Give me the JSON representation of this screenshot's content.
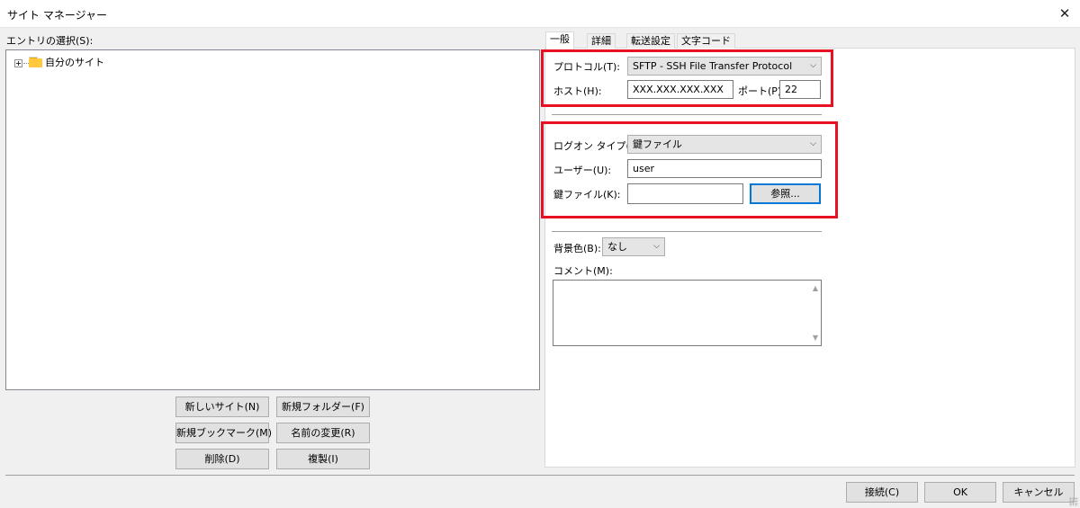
{
  "window": {
    "title": "サイト マネージャー",
    "close_glyph": "✕"
  },
  "tree": {
    "heading": "エントリの選択(S):",
    "items": [
      {
        "label": "自分のサイト",
        "icon": "folder-icon",
        "expanded": false
      }
    ]
  },
  "left_buttons": {
    "new_site": "新しいサイト(N)",
    "new_folder": "新規フォルダー(F)",
    "new_bookmark": "新規ブックマーク(M)",
    "rename": "名前の変更(R)",
    "delete": "削除(D)",
    "duplicate": "複製(I)"
  },
  "tabs": [
    {
      "label": "一般",
      "active": true
    },
    {
      "label": "詳細",
      "active": false
    },
    {
      "label": "転送設定",
      "active": false
    },
    {
      "label": "文字コード",
      "active": false
    }
  ],
  "general": {
    "protocol_label": "プロトコル(T):",
    "protocol_value": "SFTP - SSH File Transfer Protocol",
    "host_label": "ホスト(H):",
    "host_value": "XXX.XXX.XXX.XXX",
    "port_label": "ポート(P):",
    "port_value": "22",
    "logon_type_label": "ログオン タイプ(L):",
    "logon_type_value": "鍵ファイル",
    "user_label": "ユーザー(U):",
    "user_value": "user",
    "keyfile_label": "鍵ファイル(K):",
    "keyfile_value": "",
    "browse_label": "参照...",
    "bgcolor_label": "背景色(B):",
    "bgcolor_value": "なし",
    "comment_label": "コメント(M):",
    "comment_value": ""
  },
  "footer": {
    "connect": "接続(C)",
    "ok": "OK",
    "cancel": "キャンセル"
  },
  "colors": {
    "highlight_box": "#e81123",
    "focus_border": "#0078d7",
    "dialog_bg": "#f0f0f0"
  },
  "icons": {
    "chevron": "chevron-down-icon",
    "close": "close-icon"
  }
}
